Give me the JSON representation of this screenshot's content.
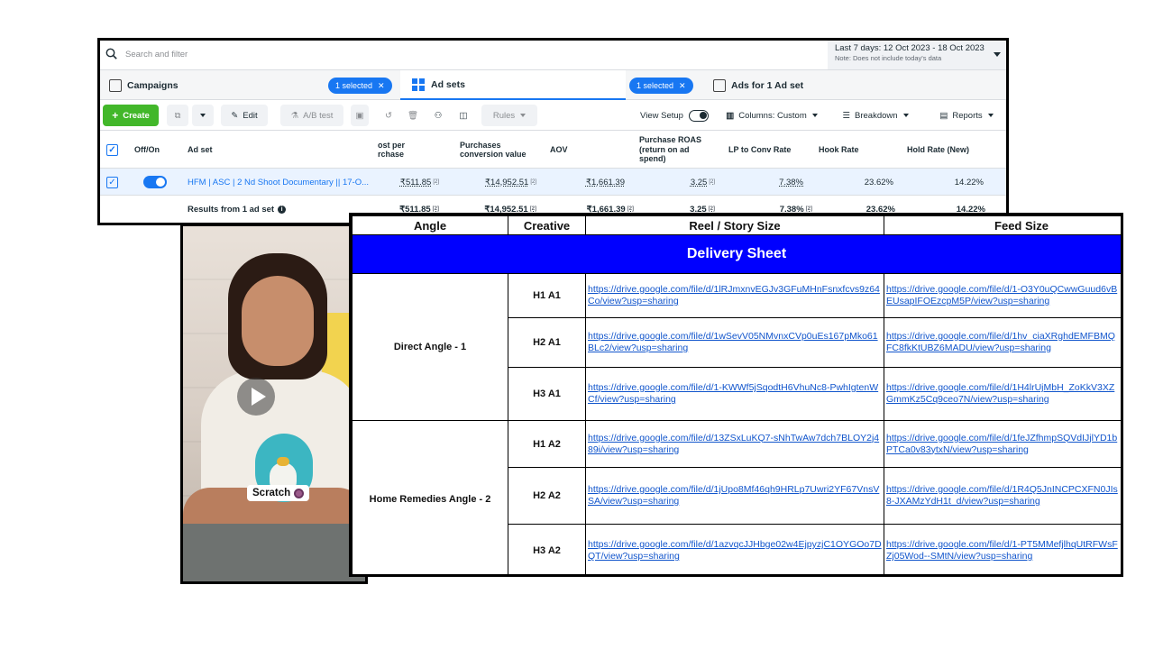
{
  "ads_manager": {
    "search_placeholder": "Search and filter",
    "date_range": "Last 7 days: 12 Oct 2023 - 18 Oct 2023",
    "date_note": "Note: Does not include today's data",
    "tabs": {
      "campaigns": "Campaigns",
      "campaigns_selected": "1 selected",
      "ad_sets": "Ad sets",
      "ad_sets_selected": "1 selected",
      "ads": "Ads for 1 Ad set"
    },
    "toolbar": {
      "create": "Create",
      "edit": "Edit",
      "ab_test": "A/B test",
      "rules": "Rules",
      "view_setup": "View Setup",
      "columns": "Columns: Custom",
      "breakdown": "Breakdown",
      "reports": "Reports"
    },
    "columns": {
      "off_on": "Off/On",
      "ad_set": "Ad set",
      "cost_per_purchase": "ost per\nrchase",
      "purchases_conv_value": "Purchases\nconversion value",
      "aov": "AOV",
      "purchase_roas": "Purchase ROAS\n(return on ad\nspend)",
      "lp_to_conv_rate": "LP to Conv Rate",
      "hook_rate": "Hook Rate",
      "hold_rate": "Hold Rate (New)"
    },
    "row": {
      "name": "HFM | ASC | 2 Nd Shoot Documentary || 17-O...",
      "cost_per_purchase": "₹511.85",
      "conv_value": "₹14,952.51",
      "aov": "₹1,661.39",
      "roas": "3.25",
      "lp_to_conv": "7.38%",
      "hook_rate": "23.62%",
      "hold_rate": "14.22%"
    },
    "totals": {
      "label": "Results from 1 ad set",
      "cost_per_purchase": "₹511.85",
      "conv_value": "₹14,952.51",
      "aov": "₹1,661.39",
      "roas": "3.25",
      "lp_to_conv": "7.38%",
      "hook_rate": "23.62%",
      "hold_rate": "14.22%"
    },
    "sup_mark": "[2]"
  },
  "video": {
    "sticker_text": "Scratch"
  },
  "delivery_sheet": {
    "headers": [
      "Angle",
      "Creative",
      "Reel / Story Size",
      "Feed Size"
    ],
    "title": "Delivery Sheet",
    "groups": [
      {
        "angle": "Direct Angle - 1",
        "rows": [
          {
            "creative": "H1 A1",
            "reel": "https://drive.google.com/file/d/1lRJmxnvEGJv3GFuMHnFsnxfcvs9z64Co/view?usp=sharing",
            "feed": "https://drive.google.com/file/d/1-O3Y0uQCwwGuud6vBEUsapIFOEzcpM5P/view?usp=sharing"
          },
          {
            "creative": "H2 A1",
            "reel": "https://drive.google.com/file/d/1wSevV05NMvnxCVp0uEs167pMko61BLc2/view?usp=sharing",
            "feed": "https://drive.google.com/file/d/1hv_ciaXRghdEMFBMQFC8fkKtUBZ6MADU/view?usp=sharing"
          },
          {
            "creative": "H3 A1",
            "reel": "https://drive.google.com/file/d/1-KWWf5jSqodtH6VhuNc8-PwhIgtenWCf/view?usp=sharing",
            "feed": "https://drive.google.com/file/d/1H4lrUjMbH_ZoKkV3XZGmmKz5Cq9ceo7N/view?usp=sharing"
          }
        ]
      },
      {
        "angle": "Home Remedies Angle - 2",
        "rows": [
          {
            "creative": "H1 A2",
            "reel": "https://drive.google.com/file/d/13ZSxLuKQ7-sNhTwAw7dch7BLOY2j489i/view?usp=sharing",
            "feed": "https://drive.google.com/file/d/1feJZfhmpSQVdIJjlYD1bPTCa0v83ytxN/view?usp=sharing"
          },
          {
            "creative": "H2 A2",
            "reel": "https://drive.google.com/file/d/1jUpo8Mf46qh9HRLp7Uwri2YF67VnsVSA/view?usp=sharing",
            "feed": "https://drive.google.com/file/d/1R4Q5JnINCPCXFN0JIs8-JXAMzYdH1t_d/view?usp=sharing"
          },
          {
            "creative": "H3 A2",
            "reel": "https://drive.google.com/file/d/1azvqcJJHbge02w4EjpyzjC1OYGOo7DQT/view?usp=sharing",
            "feed": "https://drive.google.com/file/d/1-PT5MMefjlhqUtRFWsFZj05Wod--SMtN/view?usp=sharing"
          }
        ]
      }
    ]
  },
  "colors": {
    "accent_blue": "#1877f2",
    "create_green": "#42b72a",
    "sheet_title_bg": "#0000ff",
    "link": "#1155cc"
  }
}
